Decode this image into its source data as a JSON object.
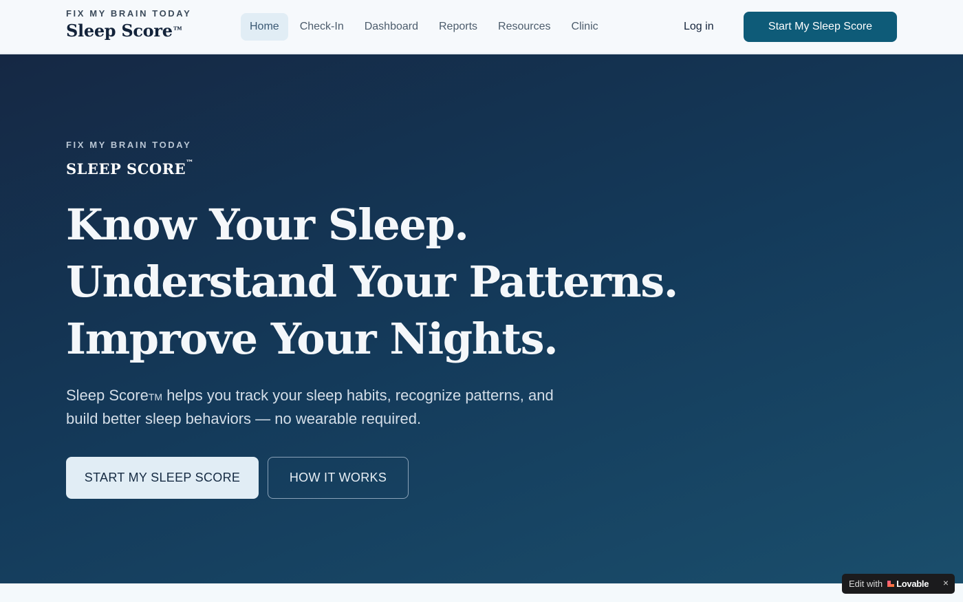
{
  "header": {
    "brand_eyebrow": "FIX MY BRAIN TODAY",
    "brand_name": "Sleep Score",
    "brand_tm": "™",
    "nav": [
      {
        "label": "Home",
        "active": true
      },
      {
        "label": "Check-In",
        "active": false
      },
      {
        "label": "Dashboard",
        "active": false
      },
      {
        "label": "Reports",
        "active": false
      },
      {
        "label": "Resources",
        "active": false
      },
      {
        "label": "Clinic",
        "active": false
      }
    ],
    "login_label": "Log in",
    "cta_label": "Start My Sleep Score"
  },
  "hero": {
    "eyebrow": "FIX MY BRAIN TODAY",
    "brand": "SLEEP SCORE",
    "brand_tm": "™",
    "title": "Know Your Sleep. Understand Your Patterns. Improve Your Nights.",
    "sub_brand": "Sleep Score",
    "sub_tm": "TM",
    "sub_rest": " helps you track your sleep habits, recognize patterns, and build better sleep behaviors — no wearable required.",
    "primary_button": "START MY SLEEP SCORE",
    "secondary_button": "HOW IT WORKS"
  },
  "badge": {
    "prefix": "Edit with",
    "brand": "Lovable",
    "close": "×",
    "icon": "lovable-heart-icon"
  },
  "colors": {
    "primary": "#0e5b78",
    "hero_bg": "#152844",
    "hero_bg_end": "#1a4e6c",
    "nav_active_bg": "#e1edf5"
  }
}
